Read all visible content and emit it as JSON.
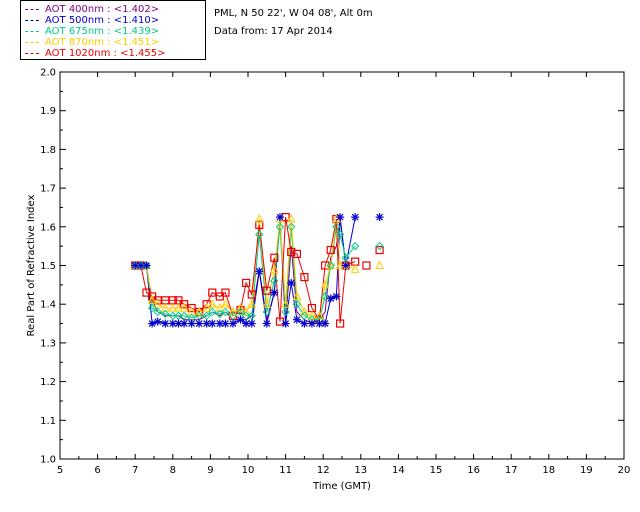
{
  "chart_data": {
    "type": "scatter",
    "xlabel": "Time (GMT)",
    "ylabel": "Real Part of Refractive Index",
    "xlim": [
      5,
      20
    ],
    "ylim": [
      1.0,
      2.0
    ],
    "xticks": [
      5,
      6,
      7,
      8,
      9,
      10,
      11,
      12,
      13,
      14,
      15,
      16,
      17,
      18,
      19,
      20
    ],
    "yticks": [
      1.0,
      1.1,
      1.2,
      1.3,
      1.4,
      1.5,
      1.6,
      1.7,
      1.8,
      1.9,
      2.0
    ],
    "grid": false,
    "legend_placement": "above-top-left",
    "annotations": [
      "PML, N 50 22', W 04 08', Alt 0m",
      "Data from: 17 Apr 2014"
    ],
    "series": [
      {
        "name": "AOT  400nm : <1.402>",
        "color": "#7f007f",
        "marker": "none",
        "x": [
          7.0,
          7.15,
          7.3,
          7.45,
          7.6,
          7.8,
          8.0,
          8.15,
          8.3,
          8.5,
          8.7,
          8.9,
          9.05,
          9.25,
          9.4,
          9.6,
          9.8,
          9.95,
          10.1,
          10.3,
          10.5,
          10.7,
          10.85,
          11.0,
          11.15,
          11.3,
          11.5,
          11.7,
          11.9,
          12.05,
          12.2,
          12.35,
          12.45,
          12.6
        ],
        "y": [
          1.5,
          1.5,
          1.5,
          1.41,
          1.38,
          1.37,
          1.37,
          1.37,
          1.36,
          1.36,
          1.36,
          1.37,
          1.38,
          1.37,
          1.38,
          1.36,
          1.36,
          1.36,
          1.37,
          1.49,
          1.36,
          1.43,
          1.62,
          1.35,
          1.55,
          1.38,
          1.36,
          1.35,
          1.36,
          1.38,
          1.52,
          1.55,
          1.62,
          1.5
        ]
      },
      {
        "name": "AOT  500nm : <1.410>",
        "color": "#0000cc",
        "marker": "star",
        "x": [
          7.0,
          7.15,
          7.3,
          7.45,
          7.6,
          7.8,
          8.0,
          8.15,
          8.3,
          8.5,
          8.7,
          8.9,
          9.05,
          9.25,
          9.4,
          9.6,
          9.8,
          9.95,
          10.1,
          10.3,
          10.5,
          10.7,
          10.85,
          11.0,
          11.15,
          11.3,
          11.5,
          11.7,
          11.9,
          12.05,
          12.2,
          12.35,
          12.45,
          12.6,
          12.85,
          13.5
        ],
        "y": [
          1.5,
          1.5,
          1.5,
          1.35,
          1.355,
          1.35,
          1.35,
          1.35,
          1.35,
          1.35,
          1.35,
          1.35,
          1.35,
          1.35,
          1.35,
          1.35,
          1.36,
          1.35,
          1.35,
          1.485,
          1.35,
          1.43,
          1.625,
          1.35,
          1.455,
          1.36,
          1.35,
          1.35,
          1.35,
          1.35,
          1.415,
          1.42,
          1.625,
          1.5,
          1.625,
          1.625
        ]
      },
      {
        "name": "AOT  675nm : <1.439>",
        "color": "#00cc88",
        "marker": "diamond",
        "x": [
          7.0,
          7.15,
          7.3,
          7.45,
          7.6,
          7.8,
          8.0,
          8.15,
          8.3,
          8.5,
          8.7,
          8.9,
          9.05,
          9.25,
          9.4,
          9.6,
          9.8,
          9.95,
          10.1,
          10.3,
          10.5,
          10.7,
          10.85,
          11.0,
          11.15,
          11.3,
          11.5,
          11.7,
          11.9,
          12.05,
          12.2,
          12.35,
          12.45,
          12.6,
          12.85,
          13.5
        ],
        "y": [
          1.5,
          1.5,
          1.5,
          1.39,
          1.38,
          1.375,
          1.37,
          1.37,
          1.37,
          1.365,
          1.37,
          1.37,
          1.38,
          1.375,
          1.38,
          1.37,
          1.38,
          1.37,
          1.37,
          1.58,
          1.38,
          1.46,
          1.6,
          1.38,
          1.6,
          1.4,
          1.37,
          1.36,
          1.36,
          1.42,
          1.5,
          1.6,
          1.58,
          1.52,
          1.55,
          1.55
        ]
      },
      {
        "name": "AOT  870nm : <1.451>",
        "color": "#ffcc00",
        "marker": "triangle",
        "x": [
          7.0,
          7.15,
          7.3,
          7.45,
          7.6,
          7.8,
          8.0,
          8.15,
          8.3,
          8.5,
          8.7,
          8.9,
          9.05,
          9.25,
          9.4,
          9.6,
          9.8,
          9.95,
          10.1,
          10.3,
          10.5,
          10.7,
          10.85,
          11.0,
          11.15,
          11.3,
          11.5,
          11.7,
          11.9,
          12.05,
          12.2,
          12.35,
          12.45,
          12.6,
          12.85,
          13.5
        ],
        "y": [
          1.5,
          1.5,
          1.5,
          1.41,
          1.4,
          1.39,
          1.39,
          1.39,
          1.39,
          1.38,
          1.38,
          1.39,
          1.4,
          1.39,
          1.4,
          1.38,
          1.39,
          1.38,
          1.4,
          1.62,
          1.4,
          1.49,
          1.62,
          1.4,
          1.62,
          1.42,
          1.38,
          1.37,
          1.37,
          1.45,
          1.5,
          1.62,
          1.5,
          1.5,
          1.49,
          1.5
        ]
      },
      {
        "name": "AOT 1020nm : <1.455>",
        "color": "#ee0000",
        "marker": "square",
        "x": [
          7.0,
          7.15,
          7.3,
          7.45,
          7.6,
          7.8,
          8.0,
          8.15,
          8.3,
          8.5,
          8.7,
          8.9,
          9.05,
          9.25,
          9.4,
          9.6,
          9.8,
          9.95,
          10.1,
          10.3,
          10.5,
          10.7,
          10.85,
          11.0,
          11.15,
          11.3,
          11.5,
          11.7,
          11.9,
          12.05,
          12.2,
          12.35,
          12.45,
          12.6,
          12.85,
          13.15,
          13.5
        ],
        "y": [
          1.5,
          1.5,
          1.43,
          1.42,
          1.41,
          1.41,
          1.41,
          1.41,
          1.4,
          1.39,
          1.38,
          1.4,
          1.43,
          1.42,
          1.43,
          1.37,
          1.385,
          1.455,
          1.425,
          1.605,
          1.435,
          1.52,
          1.355,
          1.625,
          1.535,
          1.53,
          1.47,
          1.39,
          1.36,
          1.5,
          1.54,
          1.62,
          1.35,
          1.5,
          1.51,
          1.5,
          1.54
        ]
      }
    ]
  }
}
